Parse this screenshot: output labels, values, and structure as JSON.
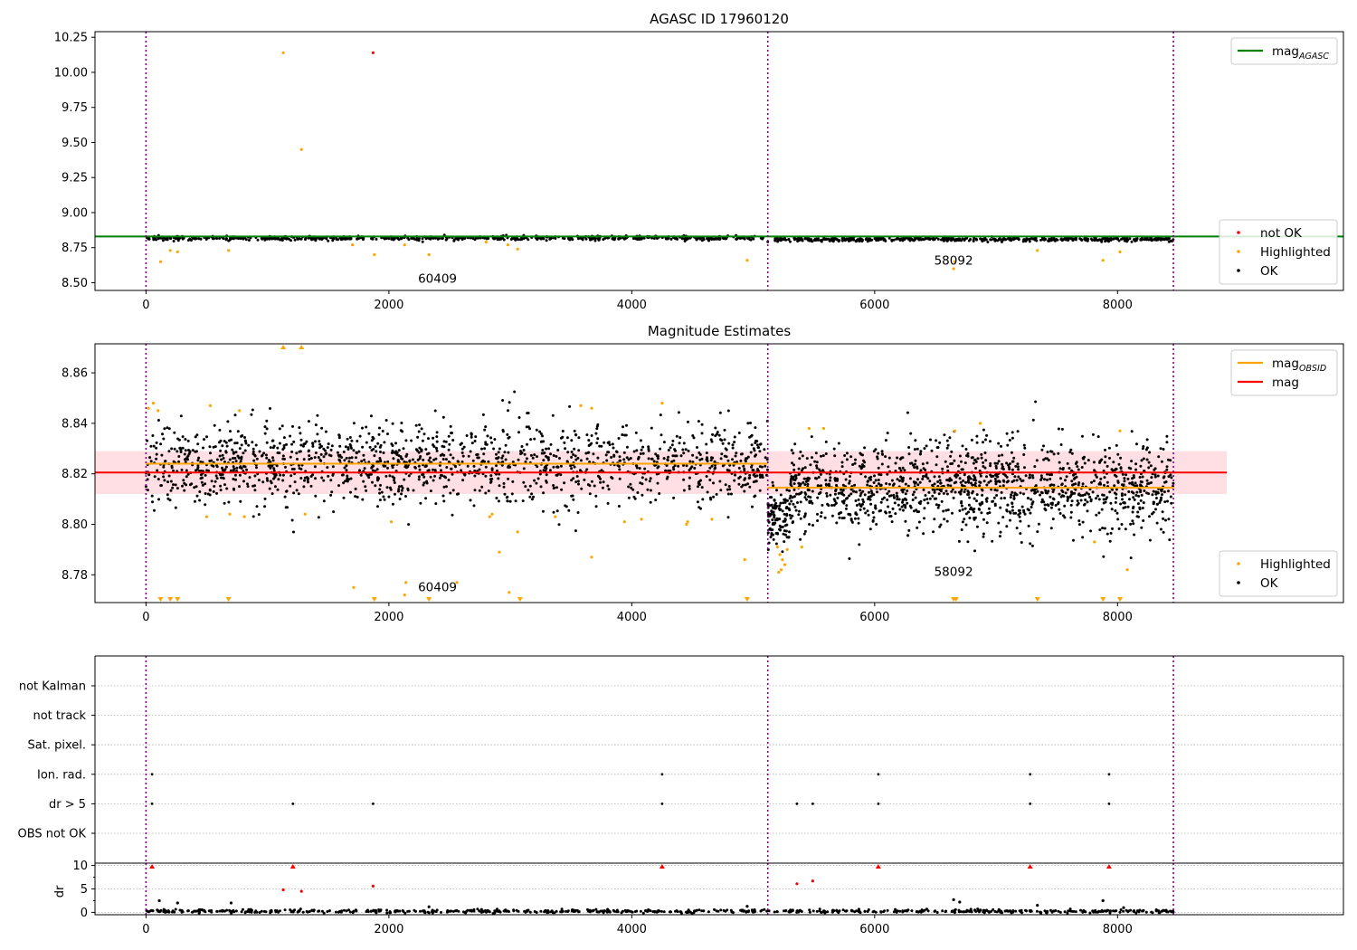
{
  "chart_data": [
    {
      "type": "scatter",
      "title": "AGASC ID 17960120",
      "xlabel": "",
      "ylabel": "",
      "xlim": [
        -420,
        9860
      ],
      "ylim": [
        8.445,
        10.29
      ],
      "xticks": [
        0,
        2000,
        4000,
        6000,
        8000
      ],
      "yticks": [
        8.5,
        8.75,
        9.0,
        9.25,
        9.5,
        9.75,
        10.0,
        10.25
      ],
      "ytick_labels": [
        "8.50",
        "8.75",
        "9.00",
        "9.25",
        "9.50",
        "9.75",
        "10.00",
        "10.25"
      ],
      "grid": false,
      "vlines": [
        0,
        5120,
        8460
      ],
      "hlines": [
        {
          "name": "mag_AGASC",
          "y": 8.83,
          "color": "#008000"
        }
      ],
      "annotations": [
        {
          "text": "60409",
          "x": 2400,
          "y": 8.5
        },
        {
          "text": "58092",
          "x": 6650,
          "y": 8.63
        }
      ],
      "legends": [
        {
          "position": "top-right",
          "entries": [
            {
              "label": "mag",
              "sub": "AGASC",
              "kind": "line",
              "color": "#008000"
            }
          ]
        },
        {
          "position": "lower-right",
          "entries": [
            {
              "label": "not OK",
              "kind": "dot",
              "color": "#ff0000"
            },
            {
              "label": "Highlighted",
              "kind": "dot",
              "color": "#ffa500"
            },
            {
              "label": "OK",
              "kind": "dot",
              "color": "#000000"
            }
          ]
        }
      ],
      "series": [
        {
          "name": "OK",
          "color": "#000000",
          "segments": [
            {
              "x_start": 0,
              "x_end": 5120,
              "y_center": 8.818,
              "y_spread": 0.014,
              "count": 650
            },
            {
              "x_start": 5120,
              "x_end": 8460,
              "y_center": 8.809,
              "y_spread": 0.014,
              "count": 520
            }
          ]
        },
        {
          "name": "Highlighted",
          "color": "#ffa500",
          "points": [
            [
              1130,
              10.14
            ],
            [
              1280,
              9.45
            ],
            [
              120,
              8.65
            ],
            [
              200,
              8.73
            ],
            [
              260,
              8.72
            ],
            [
              680,
              8.73
            ],
            [
              1700,
              8.77
            ],
            [
              1880,
              8.7
            ],
            [
              2130,
              8.77
            ],
            [
              2330,
              8.7
            ],
            [
              2800,
              8.79
            ],
            [
              2980,
              8.77
            ],
            [
              3060,
              8.74
            ],
            [
              4950,
              8.66
            ],
            [
              6650,
              8.6
            ],
            [
              6660,
              8.65
            ],
            [
              7340,
              8.73
            ],
            [
              7880,
              8.66
            ],
            [
              8020,
              8.72
            ]
          ]
        },
        {
          "name": "not OK",
          "color": "#ff0000",
          "points": [
            [
              1870,
              10.14
            ]
          ]
        }
      ]
    },
    {
      "type": "scatter",
      "title": "Magnitude Estimates",
      "xlabel": "",
      "ylabel": "",
      "xlim": [
        -420,
        9860
      ],
      "ylim": [
        8.769,
        8.8715
      ],
      "xticks": [
        0,
        2000,
        4000,
        6000,
        8000
      ],
      "yticks": [
        8.78,
        8.8,
        8.82,
        8.84,
        8.86
      ],
      "ytick_labels": [
        "8.78",
        "8.80",
        "8.82",
        "8.84",
        "8.86"
      ],
      "grid": false,
      "vlines": [
        0,
        5120,
        8460
      ],
      "band": {
        "x_start": -420,
        "x_end": 8900,
        "y_low": 8.812,
        "y_high": 8.829,
        "color": "#ffc0c8"
      },
      "hlines": [
        {
          "name": "mag",
          "y": 8.8205,
          "color": "#ff0000",
          "x_start": -420,
          "x_end": 8900
        },
        {
          "name": "mag_OBSID",
          "y": 8.824,
          "color": "#ffa500",
          "x_start": 0,
          "x_end": 5120
        },
        {
          "name": "mag_OBSID",
          "y": 8.8145,
          "color": "#ffa500",
          "x_start": 5120,
          "x_end": 8460
        }
      ],
      "annotations": [
        {
          "text": "60409",
          "x": 2400,
          "y": 8.7735
        },
        {
          "text": "58092",
          "x": 6650,
          "y": 8.7795
        }
      ],
      "legends": [
        {
          "position": "top-right",
          "entries": [
            {
              "label": "mag",
              "sub": "OBSID",
              "kind": "line",
              "color": "#ffa500"
            },
            {
              "label": "mag",
              "kind": "line",
              "color": "#ff0000"
            }
          ]
        },
        {
          "position": "lower-right",
          "entries": [
            {
              "label": "Highlighted",
              "kind": "dot",
              "color": "#ffa500"
            },
            {
              "label": "OK",
              "kind": "dot",
              "color": "#000000"
            }
          ]
        }
      ],
      "series": [
        {
          "name": "OK",
          "color": "#000000",
          "segments": [
            {
              "x_start": 0,
              "x_end": 5120,
              "y_center": 8.824,
              "y_spread": 0.016,
              "count": 1500
            },
            {
              "x_start": 5120,
              "x_end": 5300,
              "y_center": 8.803,
              "y_spread": 0.012,
              "count": 110
            },
            {
              "x_start": 5300,
              "x_end": 8460,
              "y_center": 8.8145,
              "y_spread": 0.018,
              "count": 1300
            }
          ]
        },
        {
          "name": "Highlighted",
          "color": "#ffa500",
          "points": [
            [
              20,
              8.846
            ],
            [
              60,
              8.848
            ],
            [
              100,
              8.845
            ],
            [
              530,
              8.847
            ],
            [
              770,
              8.845
            ],
            [
              4250,
              8.848
            ],
            [
              3580,
              8.847
            ],
            [
              3670,
              8.846
            ],
            [
              500,
              8.803
            ],
            [
              690,
              8.804
            ],
            [
              810,
              8.803
            ],
            [
              1310,
              8.804
            ],
            [
              2020,
              8.801
            ],
            [
              2830,
              8.803
            ],
            [
              2850,
              8.804
            ],
            [
              3060,
              8.797
            ],
            [
              3370,
              8.803
            ],
            [
              3940,
              8.801
            ],
            [
              4080,
              8.802
            ],
            [
              4450,
              8.8
            ],
            [
              4460,
              8.801
            ],
            [
              4660,
              8.802
            ],
            [
              2910,
              8.789
            ],
            [
              3670,
              8.787
            ],
            [
              4930,
              8.786
            ],
            [
              1710,
              8.775
            ],
            [
              2140,
              8.777
            ],
            [
              2560,
              8.777
            ],
            [
              2130,
              8.772
            ],
            [
              2990,
              8.773
            ],
            [
              5200,
              8.791
            ],
            [
              5220,
              8.788
            ],
            [
              5240,
              8.786
            ],
            [
              5260,
              8.784
            ],
            [
              5280,
              8.79
            ],
            [
              5230,
              8.782
            ],
            [
              5210,
              8.781
            ],
            [
              5400,
              8.791
            ],
            [
              5460,
              8.838
            ],
            [
              5580,
              8.838
            ],
            [
              6660,
              8.837
            ],
            [
              6870,
              8.84
            ],
            [
              7810,
              8.793
            ],
            [
              8020,
              8.837
            ],
            [
              8080,
              8.782
            ]
          ]
        },
        {
          "name": "Highlighted (clipped)",
          "color": "#ffa500",
          "markers": [
            {
              "x": 1130,
              "edge": "top"
            },
            {
              "x": 1280,
              "edge": "top"
            },
            {
              "x": 120,
              "edge": "bottom"
            },
            {
              "x": 200,
              "edge": "bottom"
            },
            {
              "x": 260,
              "edge": "bottom"
            },
            {
              "x": 680,
              "edge": "bottom"
            },
            {
              "x": 1880,
              "edge": "bottom"
            },
            {
              "x": 2330,
              "edge": "bottom"
            },
            {
              "x": 3080,
              "edge": "bottom"
            },
            {
              "x": 4950,
              "edge": "bottom"
            },
            {
              "x": 6650,
              "edge": "bottom"
            },
            {
              "x": 6670,
              "edge": "bottom"
            },
            {
              "x": 7340,
              "edge": "bottom"
            },
            {
              "x": 7880,
              "edge": "bottom"
            },
            {
              "x": 8020,
              "edge": "bottom"
            }
          ]
        }
      ]
    },
    {
      "type": "scatter",
      "title": "",
      "xlabel": "",
      "ylabel": "",
      "xlim": [
        -420,
        9860
      ],
      "categories": [
        "not Kalman",
        "not track",
        "Sat. pixel.",
        "Ion. rad.",
        "dr > 5",
        "OBS not OK"
      ],
      "grid": true,
      "vlines": [
        0,
        5120,
        8460
      ],
      "flags": [
        {
          "category": "Ion. rad.",
          "x": [
            50,
            4250,
            6030,
            7280,
            7930
          ]
        },
        {
          "category": "dr > 5",
          "x": [
            50,
            1210,
            1870,
            4250,
            5360,
            5490,
            6030,
            7280,
            7930
          ]
        }
      ]
    },
    {
      "type": "scatter",
      "title": "",
      "xlabel": "",
      "ylabel": "dr",
      "xlim": [
        -420,
        9860
      ],
      "ylim": [
        -0.5,
        10.5
      ],
      "yticks": [
        0,
        5,
        10
      ],
      "ytick_labels": [
        "0",
        "5",
        "10"
      ],
      "grid": true,
      "vlines": [
        0,
        5120,
        8460
      ],
      "series": [
        {
          "name": "OK",
          "color": "#000000",
          "segments": [
            {
              "x_start": 0,
              "x_end": 8460,
              "y_center": 0.25,
              "y_spread": 0.35,
              "count": 700
            }
          ],
          "points": [
            [
              110,
              2.5
            ],
            [
              260,
              2.0
            ],
            [
              700,
              2.0
            ],
            [
              2330,
              1.2
            ],
            [
              4950,
              1.3
            ],
            [
              6650,
              2.7
            ],
            [
              6700,
              2.2
            ],
            [
              7340,
              1.5
            ],
            [
              7880,
              2.5
            ],
            [
              8050,
              1.0
            ]
          ]
        },
        {
          "name": "Highlighted",
          "color": "#ff0000",
          "points": [
            [
              1130,
              4.8
            ],
            [
              1280,
              4.5
            ],
            [
              1870,
              5.6
            ],
            [
              5360,
              6.1
            ],
            [
              5490,
              6.7
            ]
          ]
        },
        {
          "name": "Clipped",
          "color": "#ff0000",
          "markers": [
            {
              "x": 50,
              "edge": "top"
            },
            {
              "x": 1210,
              "edge": "top"
            },
            {
              "x": 4250,
              "edge": "top"
            },
            {
              "x": 6030,
              "edge": "top"
            },
            {
              "x": 7280,
              "edge": "top"
            },
            {
              "x": 7930,
              "edge": "top"
            }
          ]
        }
      ]
    }
  ]
}
